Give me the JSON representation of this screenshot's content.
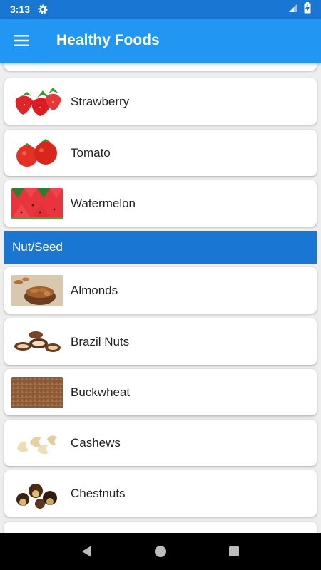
{
  "status_bar": {
    "time": "3:13",
    "gear_icon": "gear-icon",
    "signal_icon": "signal-icon",
    "battery_icon": "battery-charging-icon"
  },
  "app_bar": {
    "menu_icon": "hamburger-menu-icon",
    "title": "Healthy Foods"
  },
  "partial_top_item": {
    "image": "raspberry-image"
  },
  "fruit_items": [
    {
      "label": "Strawberry",
      "image": "strawberry-image"
    },
    {
      "label": "Tomato",
      "image": "tomato-image"
    },
    {
      "label": "Watermelon",
      "image": "watermelon-image"
    }
  ],
  "section": {
    "title": "Nut/Seed"
  },
  "nut_items": [
    {
      "label": "Almonds",
      "image": "almonds-image"
    },
    {
      "label": "Brazil Nuts",
      "image": "brazil-nuts-image"
    },
    {
      "label": "Buckwheat",
      "image": "buckwheat-image"
    },
    {
      "label": "Cashews",
      "image": "cashews-image"
    },
    {
      "label": "Chestnuts",
      "image": "chestnuts-image"
    }
  ],
  "partial_bottom_item": {
    "image": "partial-item-image"
  },
  "nav_bar": {
    "back_icon": "back-triangle-icon",
    "home_icon": "home-circle-icon",
    "recents_icon": "recents-square-icon"
  },
  "colors": {
    "status_bar": "#1976d2",
    "app_bar": "#2196f3",
    "section_header": "#1976d2",
    "background": "#eeeeee",
    "nav_bar": "#000000"
  }
}
